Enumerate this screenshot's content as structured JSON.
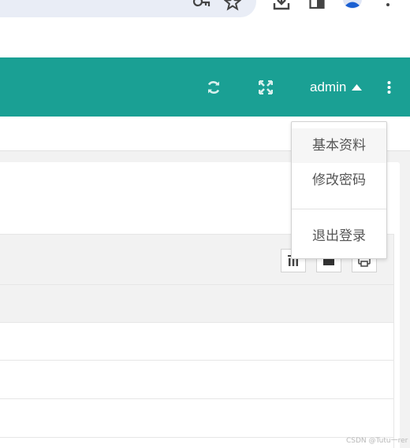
{
  "header": {
    "user_label": "admin",
    "accent_color": "#1aa094",
    "icons": [
      "refresh-icon",
      "fullscreen-icon",
      "caret-up-icon",
      "more-vertical-icon"
    ]
  },
  "browser": {
    "icons": [
      "key-icon",
      "star-icon",
      "download-icon",
      "side-panel-icon",
      "profile-avatar-icon",
      "browser-menu-icon"
    ]
  },
  "user_menu": {
    "items": [
      {
        "label": "基本资料"
      },
      {
        "label": "修改密码"
      },
      {
        "label": "退出登录"
      }
    ]
  },
  "table_toolbar": {
    "icons": [
      "columns-icon",
      "export-icon",
      "print-icon"
    ]
  },
  "watermark": "CSDN @Tutu一rer"
}
